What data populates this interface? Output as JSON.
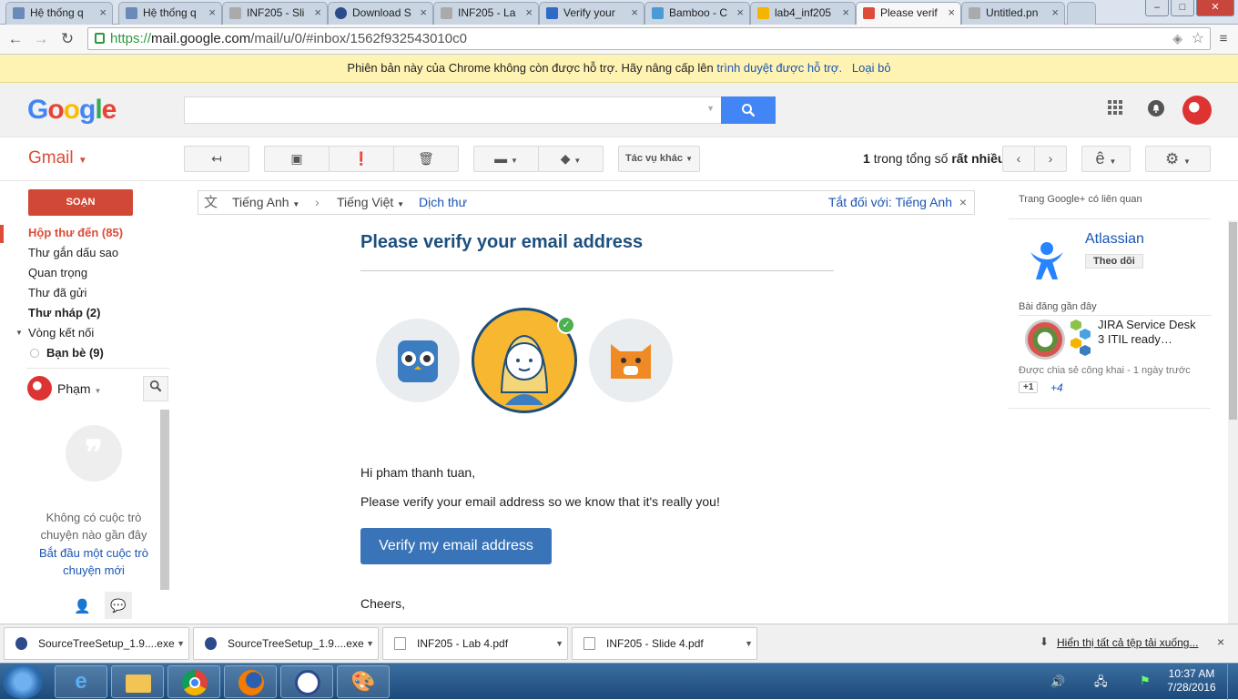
{
  "browser": {
    "tabs": [
      {
        "title": "Hệ thống q",
        "active": false
      },
      {
        "title": "Hệ thống q",
        "active": false
      },
      {
        "title": "INF205 - Sli",
        "active": false
      },
      {
        "title": "Download S",
        "active": false
      },
      {
        "title": "INF205 - La",
        "active": false
      },
      {
        "title": "Verify your",
        "active": false
      },
      {
        "title": "Bamboo - C",
        "active": false
      },
      {
        "title": "lab4_inf205",
        "active": false
      },
      {
        "title": "Please verif",
        "active": true
      },
      {
        "title": "Untitled.pn",
        "active": false
      }
    ],
    "url_scheme": "https://",
    "url_host": "mail.google.com",
    "url_path": "/mail/u/0/#inbox/1562f932543010c0",
    "infobar": {
      "text": "Phiên bản này của Chrome không còn được hỗ trợ. Hãy nâng cấp lên",
      "link": "trình duyệt được hỗ trợ.",
      "dismiss": "Loại bỏ"
    }
  },
  "google": {
    "logo": "Google",
    "search_placeholder": ""
  },
  "gmail": {
    "label": "Gmail",
    "toolbar": {
      "more_actions": "Tác vụ khác",
      "pagination_count": "1",
      "pagination_text": "trong tổng số",
      "pagination_total": "rất nhiều",
      "lang_btn": "ê"
    },
    "compose": "SOẠN",
    "nav": [
      {
        "label": "Hộp thư đến (85)"
      },
      {
        "label": "Thư gắn dấu sao"
      },
      {
        "label": "Quan trọng"
      },
      {
        "label": "Thư đã gửi"
      },
      {
        "label": "Thư nháp (2)"
      },
      {
        "label": "Vòng kết nối"
      },
      {
        "label": "Bạn bè (9)"
      }
    ],
    "hangouts": {
      "user": "Phạm",
      "empty_text": "Không có cuộc trò chuyện nào gần đây",
      "start_link": "Bắt đầu một cuộc trò chuyện mới"
    },
    "translate_bar": {
      "from_lang": "Tiếng Anh",
      "to_lang": "Tiếng Việt",
      "translate": "Dịch thư",
      "turn_off": "Tắt đối với: Tiếng Anh"
    }
  },
  "email": {
    "title": "Please verify your email address",
    "greeting": "Hi pham thanh tuan,",
    "body": "Please verify your email address so we know that it's really you!",
    "button": "Verify my email address",
    "closing": "Cheers,"
  },
  "right_panel": {
    "heading": "Trang Google+ có liên quan",
    "page_name": "Atlassian",
    "follow": "Theo dõi",
    "recent_posts": "Bài đăng gần đây",
    "post_title": "JIRA Service Desk 3 ITIL ready…",
    "post_meta": "Được chia sẻ công khai - 1 ngày trước",
    "plus_one": "+1",
    "plus_count": "+4"
  },
  "downloads": {
    "items": [
      {
        "name": "SourceTreeSetup_1.9....exe"
      },
      {
        "name": "SourceTreeSetup_1.9....exe"
      },
      {
        "name": "INF205 - Lab 4.pdf"
      },
      {
        "name": "INF205 - Slide 4.pdf"
      }
    ],
    "show_all": "Hiển thị tất cả tệp tải xuống..."
  },
  "taskbar": {
    "time": "10:37 AM",
    "date": "7/28/2016"
  },
  "colors": {
    "gmail_red": "#dd4b39",
    "compose_red": "#d14836",
    "google_blue": "#4285f4",
    "title_blue": "#1d4f7e",
    "verify_btn": "#3a74b8",
    "link_blue": "#1a55b3"
  }
}
